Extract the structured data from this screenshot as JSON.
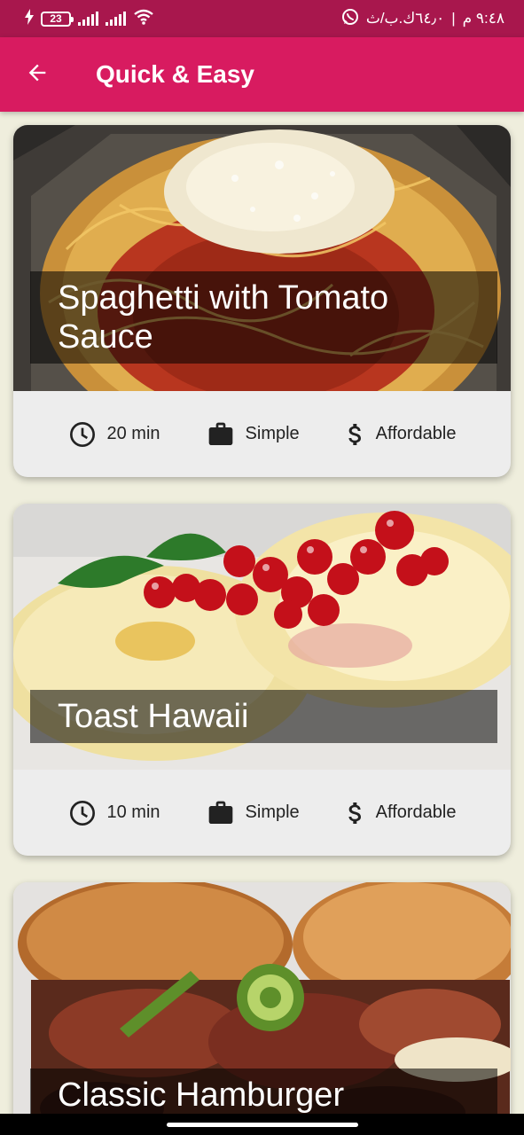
{
  "status_bar": {
    "battery_level": "23",
    "time": "٩:٤٨ م",
    "network_speed": "٦٤٫٠ك.ب/ث",
    "separator": "|"
  },
  "app_bar": {
    "title": "Quick & Easy",
    "back_icon": "arrow-back-icon"
  },
  "meals": [
    {
      "title": "Spaghetti with Tomato Sauce",
      "duration": "20 min",
      "complexity": "Simple",
      "affordability": "Affordable"
    },
    {
      "title": "Toast Hawaii",
      "duration": "10 min",
      "complexity": "Simple",
      "affordability": "Affordable"
    },
    {
      "title": "Classic Hamburger"
    }
  ],
  "icons": {
    "duration": "clock-icon",
    "complexity": "briefcase-icon",
    "affordability": "dollar-icon"
  },
  "colors": {
    "status_bar": "#a8174d",
    "app_bar": "#d81b60",
    "background": "#efeedd",
    "card": "#ededed"
  }
}
